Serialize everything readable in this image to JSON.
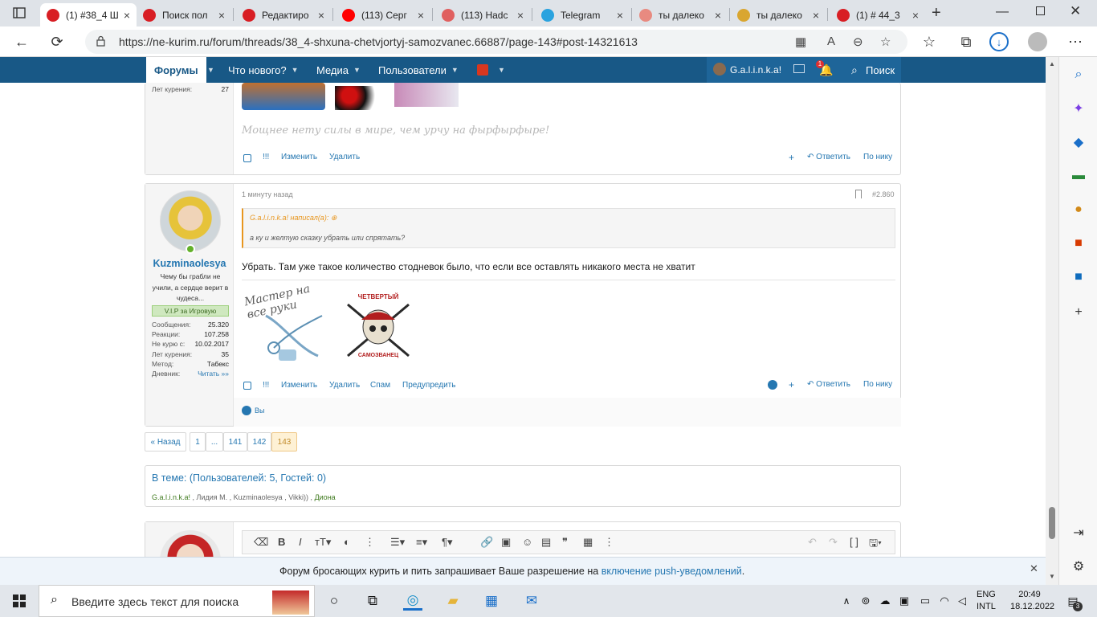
{
  "tabs": [
    {
      "title": "(1) #38_4 Ш",
      "active": true,
      "icon_color": "#d81e24",
      "icon": "forum-icon"
    },
    {
      "title": "Поиск пол",
      "active": false,
      "icon_color": "#d81e24",
      "icon": "forum-icon"
    },
    {
      "title": "Редактиро",
      "active": false,
      "icon_color": "#d81e24",
      "icon": "forum-icon"
    },
    {
      "title": "(113) Серг",
      "active": false,
      "icon_color": "#ff0000",
      "icon": "youtube-icon"
    },
    {
      "title": "(113) Hadc",
      "active": false,
      "icon_color": "#e06060",
      "icon": "youtube-icon"
    },
    {
      "title": "Telegram",
      "active": false,
      "icon_color": "#2aa3df",
      "icon": "telegram-icon"
    },
    {
      "title": "ты далеко",
      "active": false,
      "icon_color": "#e88a80",
      "icon": "yandex-icon"
    },
    {
      "title": "ты далеко",
      "active": false,
      "icon_color": "#d9a630",
      "icon": "video-icon"
    },
    {
      "title": "(1) # 44_3",
      "active": false,
      "icon_color": "#d81e24",
      "icon": "forum-icon"
    }
  ],
  "address": {
    "url": "https://ne-kurim.ru/forum/threads/38_4-shxuna-chetvjortyj-samozvanec.66887/page-143#post-14321613"
  },
  "forum_nav": {
    "forums": "Форумы",
    "whats_new": "Что нового?",
    "media": "Медиа",
    "users": "Пользователи",
    "user_name": "G.a.l.i.n.k.a!",
    "alert_count": "1",
    "search": "Поиск"
  },
  "prev_post": {
    "stat_label": "Лет курения:",
    "stat_value": "27",
    "signature": "Мощнее нету силы в мире, чем урчу на фырфырфыре!",
    "actions": [
      "!!!",
      "Изменить",
      "Удалить"
    ],
    "reply": "Ответить",
    "by_nick": "По нику"
  },
  "post": {
    "time": "1 минуту назад",
    "number": "#2.860",
    "username": "Kuzminaolesya",
    "user_title": "Чему бы грабли не учили, а сердце верит в чудеса...",
    "banner": "V.I.P за Игровую",
    "stats": [
      {
        "label": "Сообщения:",
        "value": "25.320"
      },
      {
        "label": "Реакции:",
        "value": "107.258"
      },
      {
        "label": "Не курю с:",
        "value": "10.02.2017"
      },
      {
        "label": "Лет курения:",
        "value": "35"
      },
      {
        "label": "Метод:",
        "value": "Табекс"
      },
      {
        "label": "Дневник:",
        "value": "Читать »»"
      }
    ],
    "quote_author": "G.a.l.i.n.k.a! написал(а):",
    "quote_text": "а ку и желтую сказку убрать или спрятать?",
    "body": "Убрать. Там уже такое количество стодневок было, что если все оставлять никакого места не хватит",
    "sig_left": "Мастер на все руки",
    "sig_right_top": "ЧЕТВЕРТЫЙ",
    "sig_right_bottom": "САМОЗВАНЕЦ",
    "actions": [
      "!!!",
      "Изменить",
      "Удалить",
      "Спам",
      "Предупредить"
    ],
    "reply": "Ответить",
    "by_nick": "По нику",
    "reactions": "Вы"
  },
  "pagination": {
    "prev": "« Назад",
    "pages": [
      "1",
      "...",
      "141",
      "142",
      "143"
    ],
    "current": "143"
  },
  "online": {
    "title": "В теме: (Пользователей: 5, Гостей: 0)",
    "users": [
      "G.a.l.i.n.k.a!",
      "Лидия М.",
      "Kuzminaolesya",
      "Vikki))",
      "Диона"
    ]
  },
  "notice": {
    "text": "Форум бросающих курить и пить запрашивает Ваше разрешение на",
    "link": "включение push-уведомлений",
    "end": "."
  },
  "taskbar": {
    "search_placeholder": "Введите здесь текст для поиска",
    "lang": "ENG",
    "layout": "INTL",
    "time": "20:49",
    "date": "18.12.2022",
    "notif": "3"
  },
  "colors": {
    "forum_blue": "#185886",
    "link_blue": "#2577b1",
    "username_blue": "#2577b1",
    "vip_green": "#cfe8bf",
    "quote_orange": "#e8961e"
  }
}
